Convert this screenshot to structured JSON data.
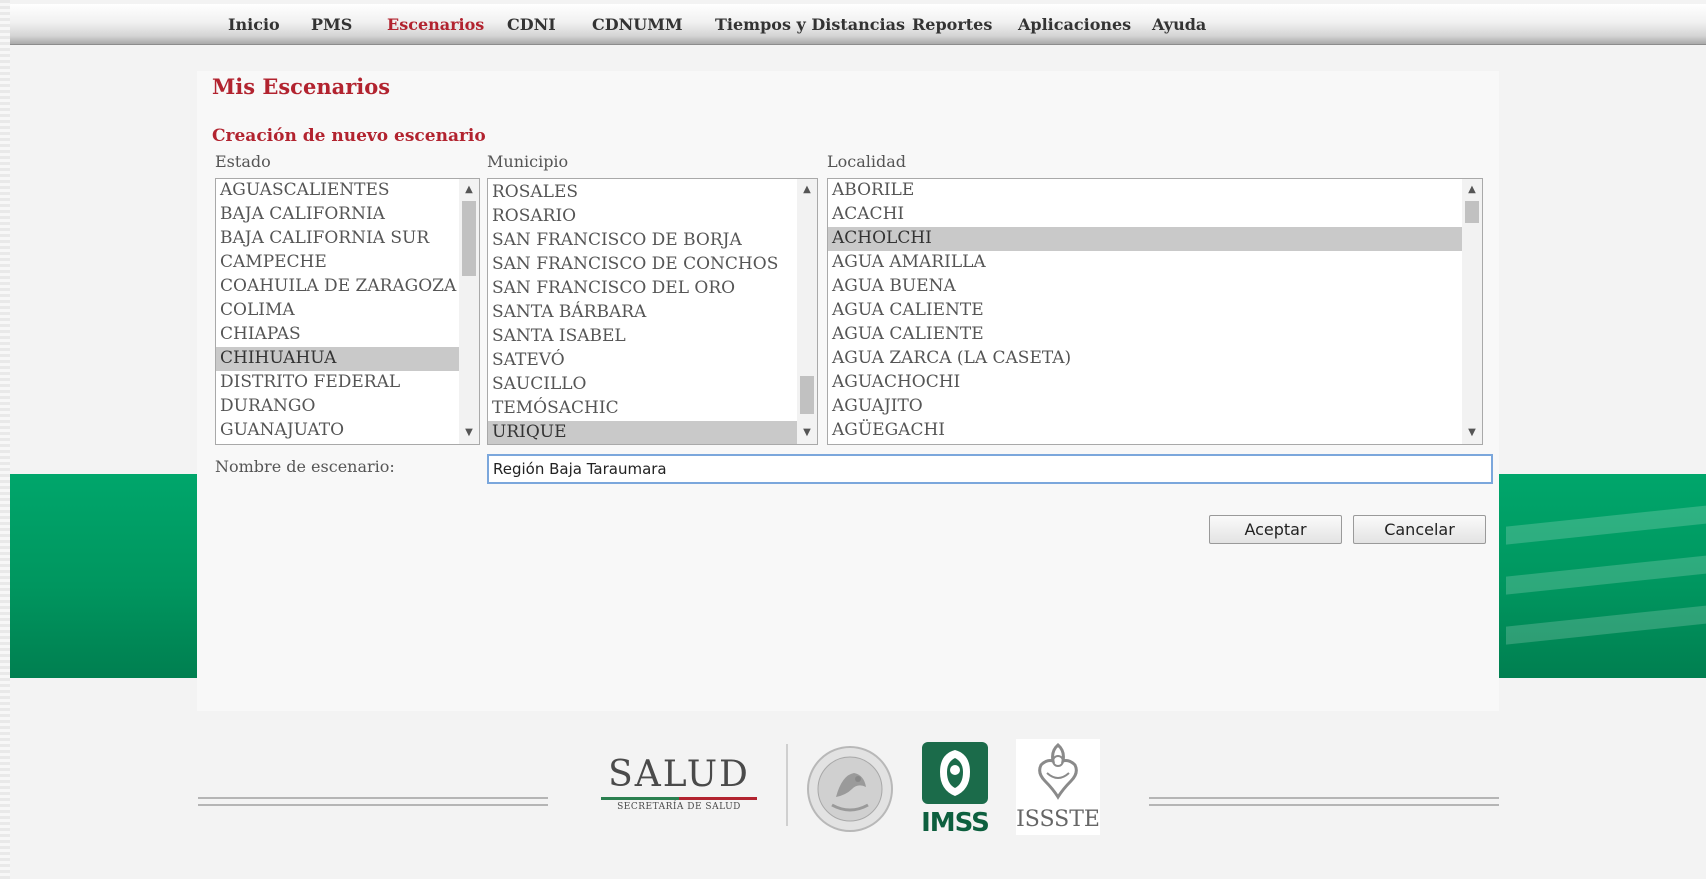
{
  "nav": {
    "items": [
      "Inicio",
      "PMS",
      "Escenarios",
      "CDNI",
      "CDNUMM",
      "Tiempos y Distancias",
      "Reportes",
      "Aplicaciones",
      "Ayuda"
    ],
    "active": "Escenarios"
  },
  "page": {
    "title": "Mis Escenarios",
    "section_title": "Creación de nuevo escenario"
  },
  "estado": {
    "label": "Estado",
    "options": [
      "AGUASCALIENTES",
      "BAJA CALIFORNIA",
      "BAJA CALIFORNIA SUR",
      "CAMPECHE",
      "COAHUILA DE ZARAGOZA",
      "COLIMA",
      "CHIAPAS",
      "CHIHUAHUA",
      "DISTRITO FEDERAL",
      "DURANGO",
      "GUANAJUATO"
    ],
    "selected": "CHIHUAHUA"
  },
  "municipio": {
    "label": "Municipio",
    "options": [
      "ROSALES",
      "ROSARIO",
      "SAN FRANCISCO DE BORJA",
      "SAN FRANCISCO DE CONCHOS",
      "SAN FRANCISCO DEL ORO",
      "SANTA BÁRBARA",
      "SANTA ISABEL",
      "SATEVÓ",
      "SAUCILLO",
      "TEMÓSACHIC",
      "URIQUE"
    ],
    "selected": "URIQUE"
  },
  "localidad": {
    "label": "Localidad",
    "options": [
      "ABORILE",
      "ACACHI",
      "ACHOLCHI",
      "AGUA AMARILLA",
      "AGUA BUENA",
      "AGUA CALIENTE",
      "AGUA CALIENTE",
      "AGUA ZARCA (LA CASETA)",
      "AGUACHOCHI",
      "AGUAJITO",
      "AGÜEGACHI"
    ],
    "selected": "ACHOLCHI"
  },
  "form": {
    "name_label": "Nombre de escenario:",
    "name_value": "Región Baja Taraumara",
    "accept_label": "Aceptar",
    "cancel_label": "Cancelar"
  },
  "footer": {
    "salud_title": "SALUD",
    "salud_subtitle": "SECRETARÍA DE SALUD",
    "imss_label": "IMSS",
    "issste_label": "ISSSTE"
  },
  "colors": {
    "accent_red": "#b2232f",
    "green_band": "#00965f",
    "imss_green": "#0d5f3e",
    "selection_gray": "#c9c9c9"
  },
  "icons": [
    "chevron-up-icon",
    "chevron-down-icon",
    "mexican-seal-icon",
    "imss-emblem-icon",
    "issste-emblem-icon"
  ]
}
